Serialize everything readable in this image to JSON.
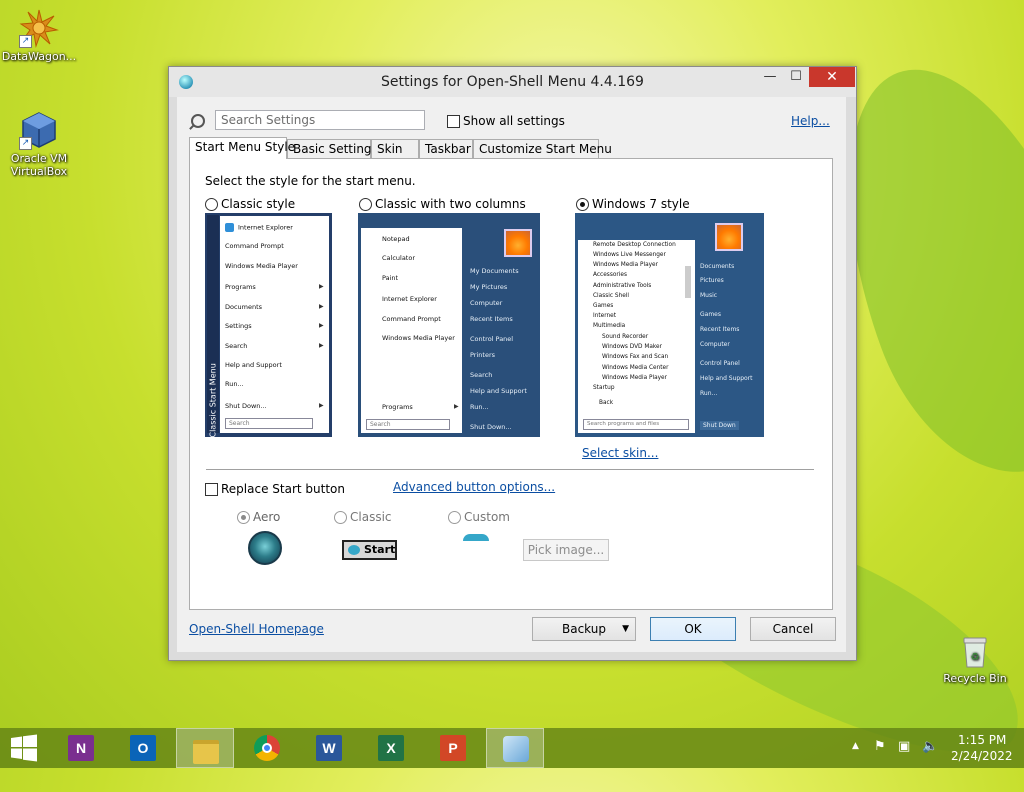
{
  "desktop": {
    "icons": [
      {
        "label": "DataWagon...",
        "icon": "sun-logo-icon"
      },
      {
        "label": "Oracle VM VirtualBox",
        "icon": "virtualbox-icon"
      },
      {
        "label": "Recycle Bin",
        "icon": "recycle-bin-icon"
      }
    ]
  },
  "window": {
    "title": "Settings for Open-Shell Menu 4.4.169",
    "controls": {
      "minimize": "—",
      "maximize": "☐",
      "close": "✕"
    }
  },
  "toolbar": {
    "search_placeholder": "Search Settings",
    "show_all_label": "Show all settings",
    "help_link": "Help..."
  },
  "tabs": [
    {
      "label": "Start Menu Style",
      "active": true
    },
    {
      "label": "Basic Settings",
      "active": false
    },
    {
      "label": "Skin",
      "active": false
    },
    {
      "label": "Taskbar",
      "active": false
    },
    {
      "label": "Customize Start Menu",
      "active": false
    }
  ],
  "style_section": {
    "prompt": "Select the style for the start menu.",
    "options": [
      {
        "label": "Classic style",
        "selected": false
      },
      {
        "label": "Classic with two columns",
        "selected": false
      },
      {
        "label": "Windows 7 style",
        "selected": true
      }
    ],
    "select_skin_link": "Select skin..."
  },
  "preview_classic": {
    "side_text": "Classic Start Menu",
    "items": [
      "Internet Explorer",
      "Command Prompt",
      "Windows Media Player",
      "Programs",
      "Documents",
      "Settings",
      "Search",
      "Help and Support",
      "Run...",
      "Shut Down..."
    ],
    "search": "Search"
  },
  "preview_two_columns": {
    "left_items": [
      "Notepad",
      "Calculator",
      "Paint",
      "Internet Explorer",
      "Command Prompt",
      "Windows Media Player"
    ],
    "programs": "Programs",
    "search": "Search",
    "right_items": [
      "My Documents",
      "My Pictures",
      "Computer",
      "Recent Items",
      "Control Panel",
      "Printers",
      "Search",
      "Help and Support",
      "Run...",
      "Shut Down..."
    ]
  },
  "preview_win7": {
    "left_items": [
      "Remote Desktop Connection",
      "Windows Live Messenger",
      "Windows Media Player",
      "Accessories",
      "Administrative Tools",
      "Classic Shell",
      "Games",
      "Internet",
      "Multimedia",
      "Sound Recorder",
      "Windows DVD Maker",
      "Windows Fax and Scan",
      "Windows Media Center",
      "Windows Media Player",
      "Startup"
    ],
    "back": "Back",
    "search": "Search programs and files",
    "right_items": [
      "Documents",
      "Pictures",
      "Music",
      "Games",
      "Recent Items",
      "Computer",
      "Control Panel",
      "Help and Support",
      "Run..."
    ],
    "shutdown": "Shut Down"
  },
  "button_section": {
    "replace_label": "Replace Start button",
    "advanced_link": "Advanced button options...",
    "options": [
      {
        "label": "Aero",
        "selected": true
      },
      {
        "label": "Classic",
        "selected": false
      },
      {
        "label": "Custom",
        "selected": false
      }
    ],
    "classic_start_label": "Start",
    "pick_image_label": "Pick image..."
  },
  "footer": {
    "homepage_link": "Open-Shell Homepage",
    "backup_label": "Backup",
    "ok_label": "OK",
    "cancel_label": "Cancel"
  },
  "taskbar": {
    "apps": [
      {
        "name": "onenote",
        "glyph": "N",
        "color": "#7a2f8f"
      },
      {
        "name": "outlook",
        "glyph": "O",
        "color": "#0a64b8"
      },
      {
        "name": "file-explorer",
        "glyph": "",
        "color": "#e7c54a"
      },
      {
        "name": "chrome",
        "glyph": "",
        "color": "#dd4433"
      },
      {
        "name": "word",
        "glyph": "W",
        "color": "#2b579a"
      },
      {
        "name": "excel",
        "glyph": "X",
        "color": "#217346"
      },
      {
        "name": "powerpoint",
        "glyph": "P",
        "color": "#d24726"
      },
      {
        "name": "settings-app",
        "glyph": "",
        "color": "#6aa7d8"
      }
    ],
    "time": "1:15 PM",
    "date": "2/24/2022"
  }
}
